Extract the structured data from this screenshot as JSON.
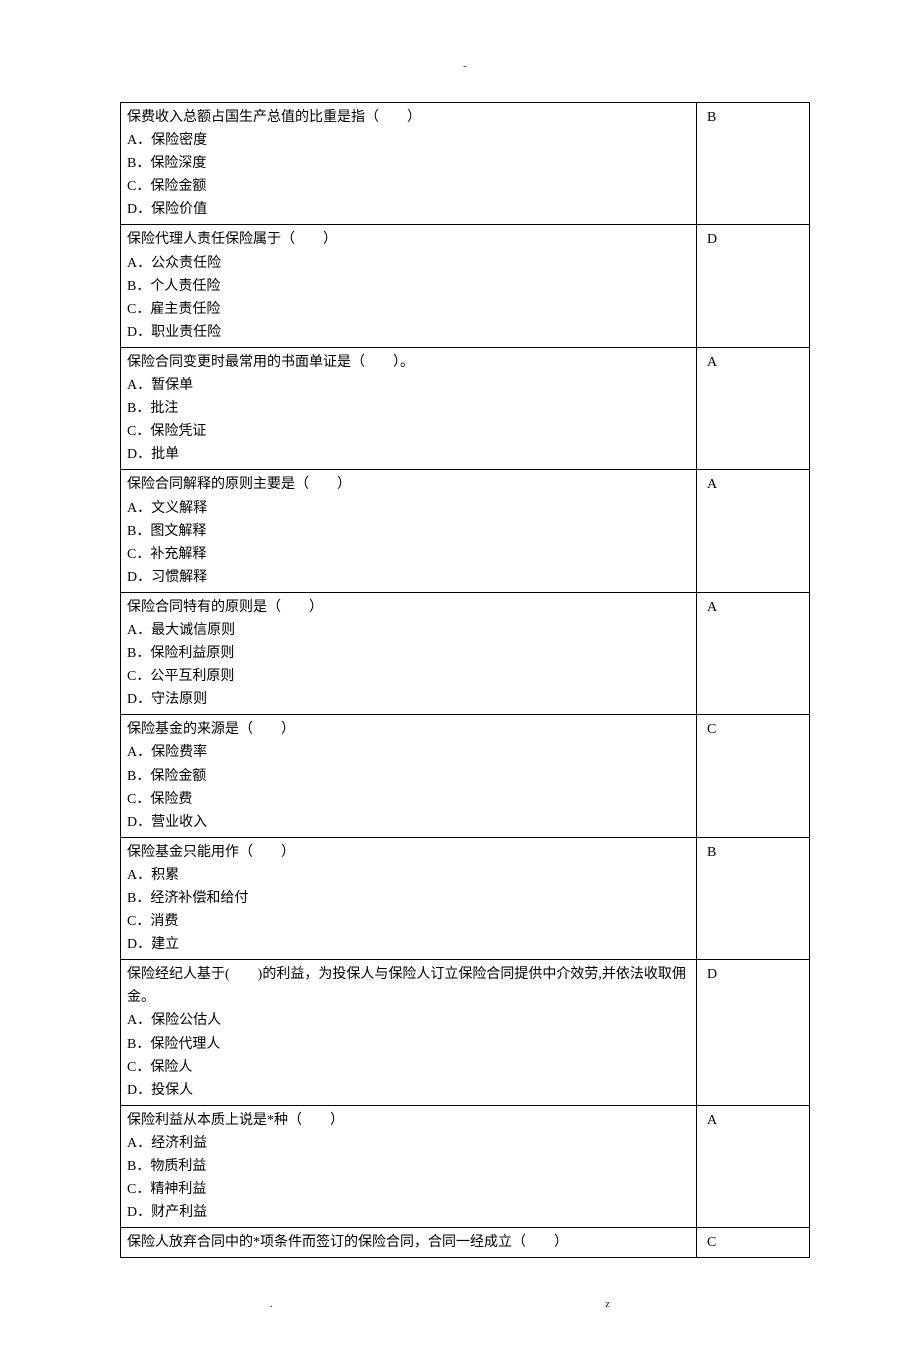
{
  "top_marker": "-",
  "footer_left": ".",
  "footer_right": "z",
  "rows": [
    {
      "question": "保费收入总额占国生产总值的比重是指（　　）",
      "options": [
        "A．保险密度",
        "B．保险深度",
        "C．保险金额",
        "D．保险价值"
      ],
      "answer": "B"
    },
    {
      "question": "保险代理人责任保险属于（　　）",
      "options": [
        "A．公众责任险",
        "B．个人责任险",
        "C．雇主责任险",
        "D．职业责任险"
      ],
      "answer": "D"
    },
    {
      "question": "保险合同变更时最常用的书面单证是（　　）。",
      "options": [
        "A．暂保单",
        "B．批注",
        "C．保险凭证",
        "D．批单"
      ],
      "answer": "A"
    },
    {
      "question": "保险合同解释的原则主要是（　　）",
      "options": [
        "A．文义解释",
        "B．图文解释",
        "C．补充解释",
        "D．习惯解释"
      ],
      "answer": "A"
    },
    {
      "question": "保险合同特有的原则是（　　）",
      "options": [
        "A．最大诚信原则",
        "B．保险利益原则",
        "C．公平互利原则",
        "D．守法原则"
      ],
      "answer": "A"
    },
    {
      "question": "保险基金的来源是（　　）",
      "options": [
        "A．保险费率",
        "B．保险金额",
        "C．保险费",
        "D．营业收入"
      ],
      "answer": "C"
    },
    {
      "question": "保险基金只能用作（　　）",
      "options": [
        "A．积累",
        "B．经济补偿和给付",
        "C．消费",
        "D．建立"
      ],
      "answer": "B"
    },
    {
      "question": "保险经纪人基于(　　)的利益，为投保人与保险人订立保险合同提供中介效劳,并依法收取佣金。",
      "options": [
        "A．保险公估人",
        "B．保险代理人",
        "C．保险人",
        "D．投保人"
      ],
      "answer": "D"
    },
    {
      "question": "保险利益从本质上说是*种（　　）",
      "options": [
        "A．经济利益",
        "B．物质利益",
        "C．精神利益",
        "D．财产利益"
      ],
      "answer": "A"
    },
    {
      "question": "保险人放弃合同中的*项条件而签订的保险合同，合同一经成立（　　）",
      "options": [],
      "answer": "C"
    }
  ]
}
